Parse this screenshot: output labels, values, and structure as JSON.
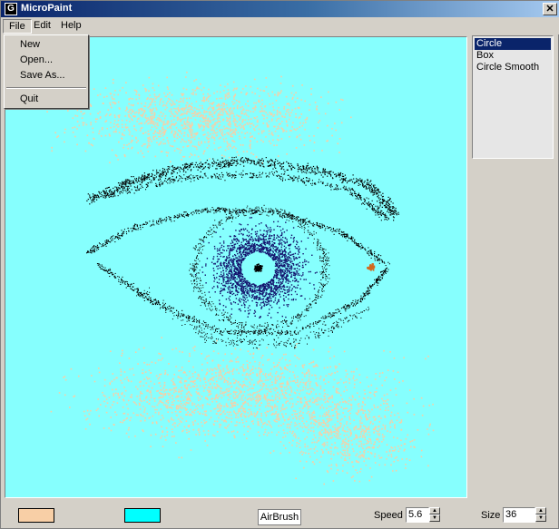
{
  "window": {
    "title": "MicroPaint",
    "app_icon": "G",
    "close_glyph": "✕"
  },
  "menubar": {
    "file": "File",
    "edit": "Edit",
    "help": "Help"
  },
  "file_menu": {
    "new": "New",
    "open": "Open...",
    "save_as": "Save As...",
    "quit": "Quit"
  },
  "shapes": {
    "items": [
      "Circle",
      "Box",
      "Circle Smooth"
    ],
    "selected": "Circle"
  },
  "tool": {
    "name": "AirBrush"
  },
  "speed": {
    "label": "Speed",
    "value": "5.6"
  },
  "size": {
    "label": "Size",
    "value": "36"
  },
  "colors": {
    "primary": "#f8cfa6",
    "secondary": "#00ffff",
    "canvas_bg": "#86fffe",
    "ink": "#000000",
    "iris": "#14146e",
    "accent": "#d2691e"
  },
  "icons": {
    "spin_up": "▲",
    "spin_down": "▼"
  }
}
